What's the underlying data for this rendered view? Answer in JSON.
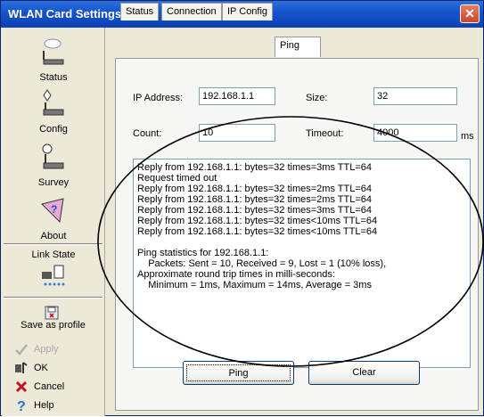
{
  "window": {
    "title": "WLAN Card Settings"
  },
  "sidebar": {
    "nav": [
      {
        "label": "Status"
      },
      {
        "label": "Config"
      },
      {
        "label": "Survey"
      },
      {
        "label": "About"
      }
    ],
    "link_state": {
      "label": "Link State"
    },
    "actions": [
      {
        "label": "Save as profile",
        "enabled": true
      },
      {
        "label": "Apply",
        "enabled": false
      },
      {
        "label": "OK",
        "enabled": true
      },
      {
        "label": "Cancel",
        "enabled": true
      },
      {
        "label": "Help",
        "enabled": true
      }
    ]
  },
  "tabs": [
    {
      "label": "Status"
    },
    {
      "label": "Connection"
    },
    {
      "label": "IP Config"
    },
    {
      "label": "Ping",
      "active": true
    }
  ],
  "ping": {
    "ip_label": "IP Address:",
    "ip_value": "192.168.1.1",
    "size_label": "Size:",
    "size_value": "32",
    "count_label": "Count:",
    "count_value": "10",
    "timeout_label": "Timeout:",
    "timeout_value": "4000",
    "timeout_unit": "ms",
    "output": "Reply from 192.168.1.1: bytes=32 times=3ms TTL=64\nRequest timed out\nReply from 192.168.1.1: bytes=32 times=2ms TTL=64\nReply from 192.168.1.1: bytes=32 times=2ms TTL=64\nReply from 192.168.1.1: bytes=32 times=3ms TTL=64\nReply from 192.168.1.1: bytes=32 times<10ms TTL=64\nReply from 192.168.1.1: bytes=32 times<10ms TTL=64\n\nPing statistics for 192.168.1.1:\n    Packets: Sent = 10, Received = 9, Lost = 1 (10% loss),\nApproximate round trip times in milli-seconds:\n    Minimum = 1ms, Maximum = 14ms, Average = 3ms",
    "ping_button": "Ping",
    "clear_button": "Clear"
  },
  "colors": {
    "title_bar": "#1552C9",
    "panel": "#ECE9D8",
    "annotation": "#000000"
  }
}
